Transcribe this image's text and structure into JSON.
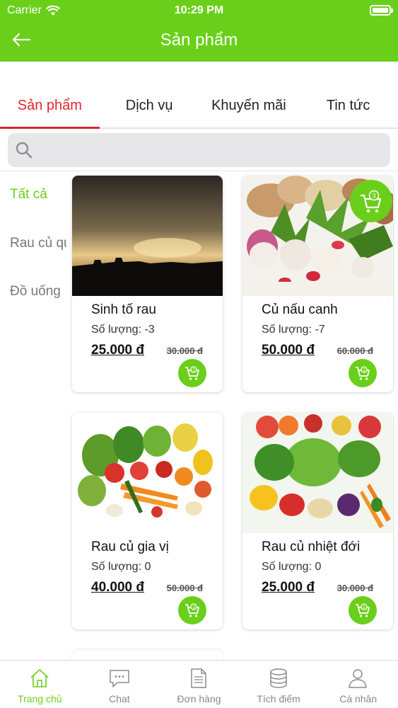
{
  "status_bar": {
    "carrier": "Carrier",
    "time": "10:29 PM"
  },
  "header": {
    "title": "Sản phẩm",
    "back_icon": "arrow-left-icon"
  },
  "tabs": [
    {
      "label": "Sản phẩm",
      "active": true
    },
    {
      "label": "Dịch vụ",
      "active": false
    },
    {
      "label": "Khuyến mãi",
      "active": false
    },
    {
      "label": "Tin tức",
      "active": false
    }
  ],
  "search": {
    "placeholder": ""
  },
  "categories": [
    {
      "label": "Tất cả",
      "active": true
    },
    {
      "label": "Rau củ quả",
      "active": false
    },
    {
      "label": "Đồ uống",
      "active": false
    }
  ],
  "floating_cart": {
    "count": "3"
  },
  "products": [
    {
      "name": "Sinh tố rau",
      "quantity": "Số lượng: -3",
      "price": "25.000 đ",
      "old_price": "30.000 đ",
      "cart_count": "3"
    },
    {
      "name": "Củ nấu canh",
      "quantity": "Số lượng: -7",
      "price": "50.000 đ",
      "old_price": "60.000 đ",
      "cart_count": "3"
    },
    {
      "name": "Rau củ gia vị",
      "quantity": "Số lượng: 0",
      "price": "40.000 đ",
      "old_price": "50.000 đ",
      "cart_count": "3"
    },
    {
      "name": "Rau củ nhiệt đới",
      "quantity": "Số lượng: 0",
      "price": "25.000 đ",
      "old_price": "30.000 đ",
      "cart_count": "3"
    }
  ],
  "bottom_nav": [
    {
      "label": "Trang chủ",
      "icon": "home-icon",
      "active": true
    },
    {
      "label": "Chat",
      "icon": "chat-icon",
      "active": false
    },
    {
      "label": "Đơn hàng",
      "icon": "document-icon",
      "active": false
    },
    {
      "label": "Tích điểm",
      "icon": "coins-icon",
      "active": false
    },
    {
      "label": "Cá nhân",
      "icon": "user-icon",
      "active": false
    }
  ],
  "colors": {
    "accent": "#6acf1a",
    "active_tab": "#e1252f"
  }
}
